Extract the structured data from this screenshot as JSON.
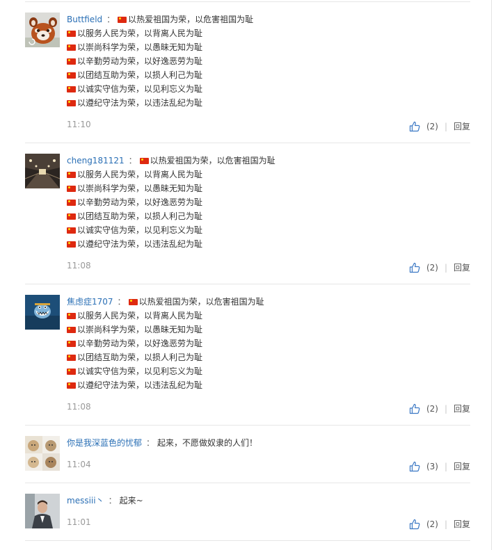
{
  "comments": [
    {
      "username": "Buttfield",
      "lines": [
        "以热爱祖国为荣，以危害祖国为耻",
        "以服务人民为荣，以背离人民为耻",
        "以崇尚科学为荣，以愚昧无知为耻",
        "以辛勤劳动为荣，以好逸恶劳为耻",
        "以团结互助为荣，以损人利己为耻",
        "以诚实守信为荣，以见利忘义为耻",
        "以遵纪守法为荣，以违法乱纪为耻"
      ],
      "time": "11:10",
      "likes": "(2)",
      "reply_label": "回复",
      "avatar": "red-panda-avatar"
    },
    {
      "username": "cheng181121",
      "lines": [
        "以热爱祖国为荣，以危害祖国为耻",
        "以服务人民为荣，以背离人民为耻",
        "以崇尚科学为荣，以愚昧无知为耻",
        "以辛勤劳动为荣，以好逸恶劳为耻",
        "以团结互助为荣，以损人利己为耻",
        "以诚实守信为荣，以见利忘义为耻",
        "以遵纪守法为荣，以违法乱纪为耻"
      ],
      "time": "11:08",
      "likes": "(2)",
      "reply_label": "回复",
      "avatar": "tunnel-avatar"
    },
    {
      "username": "焦虑症1707",
      "lines": [
        "以热爱祖国为荣，以危害祖国为耻",
        "以服务人民为荣，以背离人民为耻",
        "以崇尚科学为荣，以愚昧无知为耻",
        "以辛勤劳动为荣，以好逸恶劳为耻",
        "以团结互助为荣，以损人利己为耻",
        "以诚实守信为荣，以见利忘义为耻",
        "以遵纪守法为荣，以违法乱纪为耻"
      ],
      "time": "11:08",
      "likes": "(2)",
      "reply_label": "回复",
      "avatar": "cartoon-avatar"
    },
    {
      "username": "你是我深蓝色的忧郁",
      "text": "起来，不愿做奴隶的人们！",
      "time": "11:04",
      "likes": "(3)",
      "reply_label": "回复",
      "avatar": "cats-avatar"
    },
    {
      "username": "messiii丶",
      "text": "起来~",
      "time": "11:01",
      "likes": "(2)",
      "reply_label": "回复",
      "avatar": "man-avatar"
    }
  ],
  "colors": {
    "username": "#2a6fb5",
    "like_icon": "#3b78c4",
    "flag_red": "#de2910",
    "flag_star": "#ffde00",
    "time": "#999999"
  }
}
